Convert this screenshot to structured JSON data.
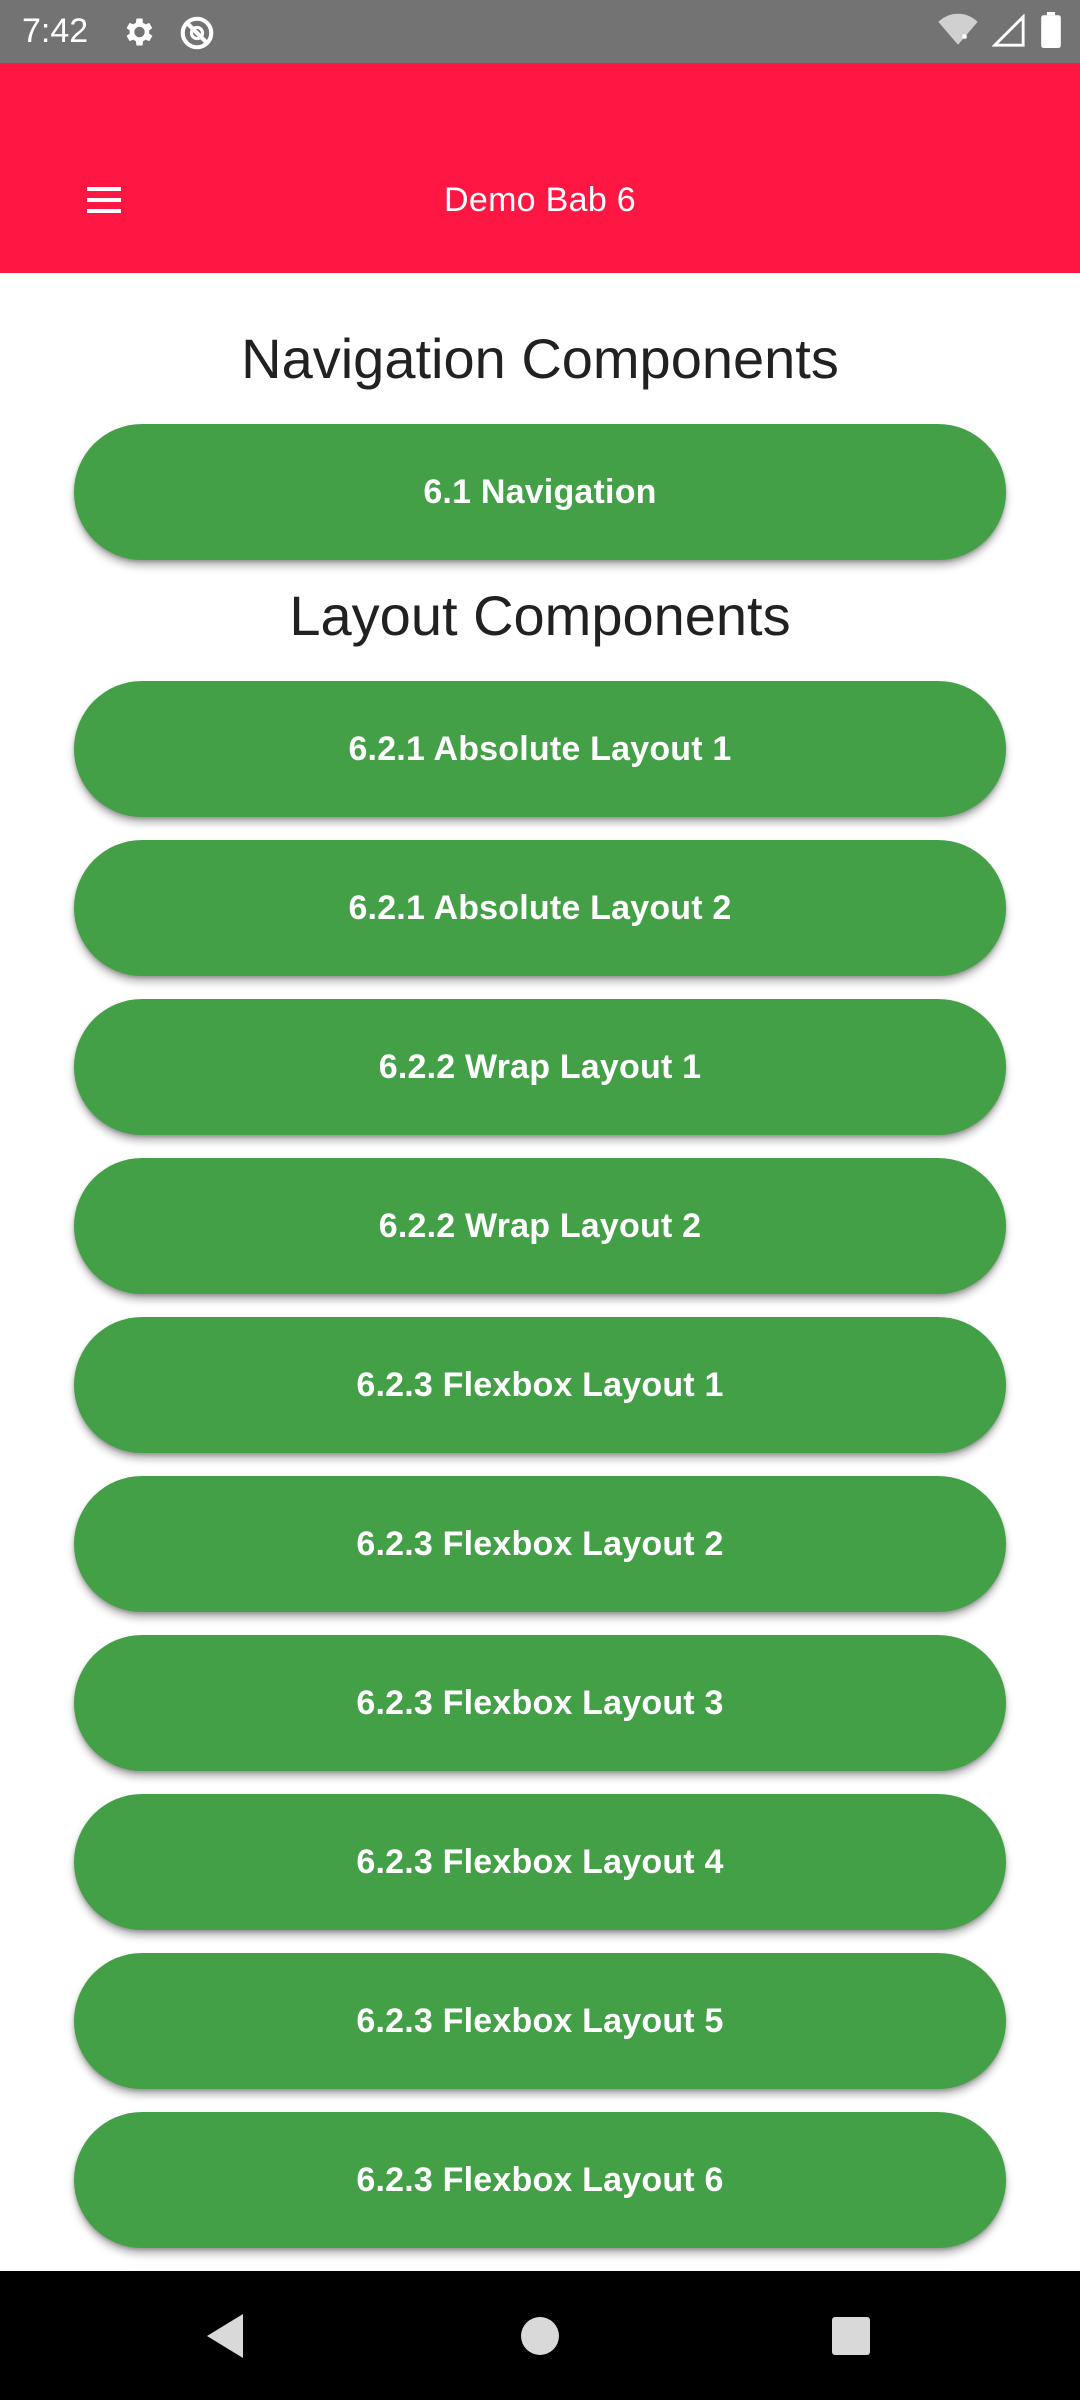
{
  "status_bar": {
    "time": "7:42",
    "icons_left": [
      "gear-icon",
      "data-saver-icon"
    ],
    "icons_right": [
      "wifi-off-icon",
      "signal-icon",
      "battery-icon"
    ]
  },
  "app_bar": {
    "title": "Demo Bab 6",
    "menu_icon": "hamburger-menu-icon",
    "color": "#ff1744"
  },
  "sections": {
    "navigation": {
      "heading": "Navigation Components",
      "buttons": [
        "6.1 Navigation"
      ]
    },
    "layout": {
      "heading": "Layout Components",
      "buttons": [
        "6.2.1 Absolute Layout 1",
        "6.2.1 Absolute Layout 2",
        "6.2.2 Wrap Layout 1",
        "6.2.2 Wrap Layout 2",
        "6.2.3 Flexbox Layout 1",
        "6.2.3 Flexbox Layout 2",
        "6.2.3 Flexbox Layout 3",
        "6.2.3 Flexbox Layout 4",
        "6.2.3 Flexbox Layout 5",
        "6.2.3 Flexbox Layout 6",
        ""
      ]
    }
  },
  "colors": {
    "button": "#43a047",
    "status_bar": "#737373",
    "nav_bar": "#000000"
  },
  "nav_bar": {
    "icons": [
      "back-icon",
      "home-icon",
      "recents-icon"
    ]
  }
}
